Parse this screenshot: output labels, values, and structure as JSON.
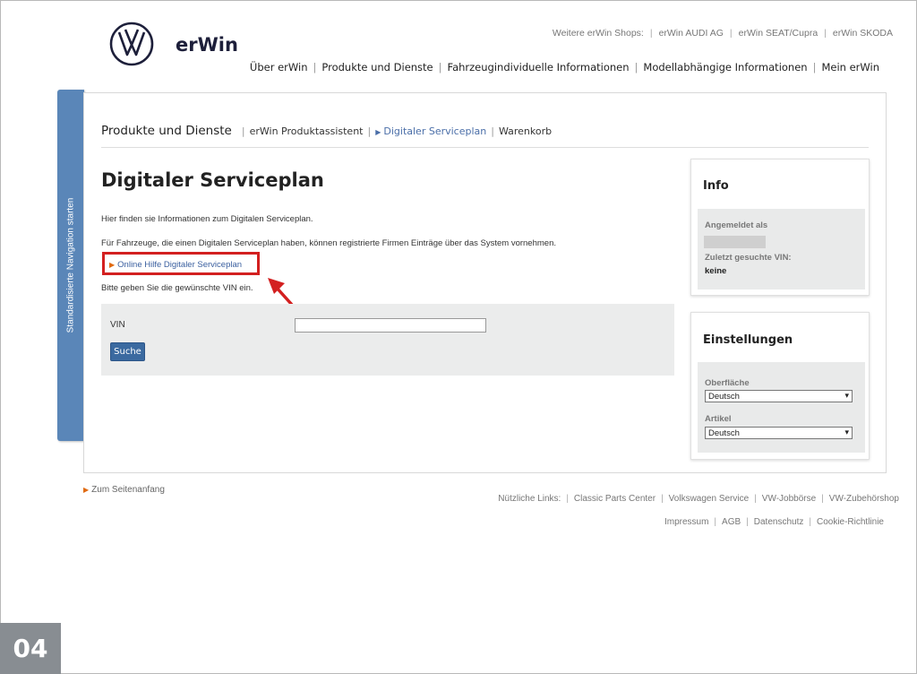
{
  "header": {
    "brand": "erWin",
    "shops_label": "Weitere erWin Shops:",
    "shops": [
      "erWin AUDI AG",
      "erWin SEAT/Cupra",
      "erWin SKODA"
    ],
    "nav": [
      "Über erWin",
      "Produkte und Dienste",
      "Fahrzeugindividuelle Informationen",
      "Modellabhängige Informationen",
      "Mein erWin"
    ]
  },
  "sidetab": {
    "label": "Standardisierte Navigation starten"
  },
  "breadcrumb": {
    "root": "Produkte und Dienste",
    "items": [
      "erWin Produktassistent",
      "Digitaler Serviceplan",
      "Warenkorb"
    ]
  },
  "main": {
    "title": "Digitaler Serviceplan",
    "intro": "Hier finden sie Informationen zum Digitalen Serviceplan.",
    "para2": "Für Fahrzeuge, die einen Digitalen Serviceplan haben, können registrierte Firmen Einträge über das System vornehmen.",
    "help_link": "Online Hilfe Digitaler Serviceplan",
    "vin_prompt": "Bitte geben Sie die gewünschte VIN ein.",
    "vin_label": "VIN",
    "vin_value": "",
    "search_label": "Suche"
  },
  "info": {
    "title": "Info",
    "logged_in_label": "Angemeldet als",
    "last_vin_label": "Zuletzt gesuchte VIN:",
    "last_vin_value": "keine"
  },
  "settings": {
    "title": "Einstellungen",
    "surface_label": "Oberfläche",
    "surface_value": "Deutsch",
    "article_label": "Artikel",
    "article_value": "Deutsch"
  },
  "footer": {
    "top_link": "Zum Seitenanfang",
    "useful_label": "Nützliche Links:",
    "useful_links": [
      "Classic Parts Center",
      "Volkswagen Service",
      "VW-Jobbörse",
      "VW-Zubehörshop"
    ],
    "legal_links": [
      "Impressum",
      "AGB",
      "Datenschutz",
      "Cookie-Richtlinie"
    ]
  },
  "page_badge": "04",
  "colors": {
    "accent_blue": "#3b6aa0",
    "highlight_red": "#d32020",
    "link_blue": "#3a5f9f",
    "side_tab": "#5a86b8"
  }
}
